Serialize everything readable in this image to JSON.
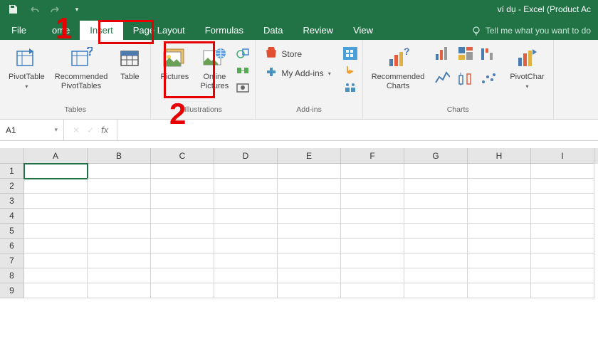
{
  "title": "ví dụ - Excel (Product Ac",
  "tabs": {
    "file": "File",
    "home": "ome",
    "insert": "Insert",
    "page_layout": "Page Layout",
    "formulas": "Formulas",
    "data": "Data",
    "review": "Review",
    "view": "View"
  },
  "tell_me": "Tell me what you want to do",
  "ribbon": {
    "tables": {
      "label": "Tables",
      "pivot_table": "PivotTable",
      "recommended_pivot": "Recommended\nPivotTables",
      "table": "Table"
    },
    "illustrations": {
      "label": "Illustrations",
      "pictures": "Pictures",
      "online_pictures": "Online\nPictures"
    },
    "addins": {
      "label": "Add-ins",
      "store": "Store",
      "my_addins": "My Add-ins"
    },
    "charts": {
      "label": "Charts",
      "recommended": "Recommended\nCharts",
      "pivotchart": "PivotChar"
    }
  },
  "formula_bar": {
    "name_box": "A1",
    "fx": "fx"
  },
  "columns": [
    "A",
    "B",
    "C",
    "D",
    "E",
    "F",
    "G",
    "H",
    "I"
  ],
  "rows": [
    "1",
    "2",
    "3",
    "4",
    "5",
    "6",
    "7",
    "8",
    "9"
  ],
  "annotations": {
    "n1": "1",
    "n2": "2"
  }
}
